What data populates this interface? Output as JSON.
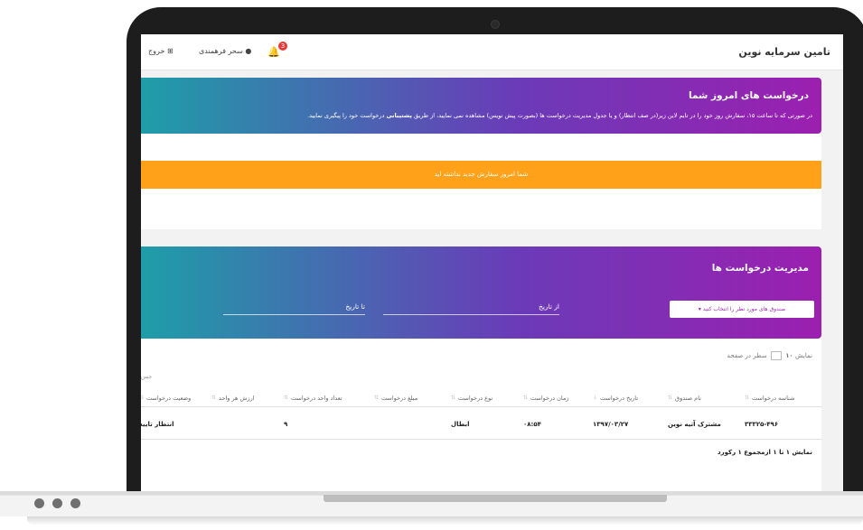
{
  "navbar": {
    "brand": "تامین سرمایه نوین",
    "notification_count": "3",
    "user_name": "سحر فرهمندی",
    "logout_label": "خروج"
  },
  "today_requests": {
    "title": "درخواست های امروز شما",
    "description_1": "در صورتی که تا ساعت ۱۵، سفارش روز خود را در تایم لاین زیر(در صف انتظار) و یا جدول مدیریت درخواست ها (بصورت پیش نویس) مشاهده نمی نمایید، از طریق",
    "description_bold": "پشتیبانی",
    "description_2": "درخواست خود را پیگیری نمایید.",
    "no_orders_message": "شما امروز سفارش جدید نداشته اید"
  },
  "management": {
    "title": "مدیریت درخواست ها",
    "from_date_label": "از تاریخ",
    "to_date_label": "تا تاریخ",
    "select_funds_label": "صندوق های مورد نظر را انتخاب کنید",
    "perpage_prefix": "نمایش",
    "perpage_value": "۱۰",
    "perpage_suffix": "سطر در صفحه",
    "search_fragment": "جس",
    "footer": "نمایش ۱ تا ۱ ازمجموع ۱ رکورد"
  },
  "table": {
    "columns": [
      "شناسه درخواست",
      "نام صندوق",
      "تاریخ درخواست",
      "زمان درخواست",
      "نوع درخواست",
      "مبلغ درخواست",
      "تعداد واحد درخواست",
      "ارزش هر واحد",
      "وضعیت درخواست"
    ],
    "rows": [
      [
        "۳۳۳۲۵-۴۹۶",
        "مشترک آتیه نوین",
        "۱۳۹۷/۰۳/۲۷",
        "۰۸:۵۴",
        "ابطال",
        "",
        "۹",
        "",
        "انتظار تایید"
      ]
    ]
  },
  "colors": {
    "gradient_start": "#9c1fb0",
    "gradient_mid": "#6a3bb8",
    "gradient_end": "#1e9ea8",
    "orange": "#ffa21a",
    "badge_red": "#e53935"
  }
}
